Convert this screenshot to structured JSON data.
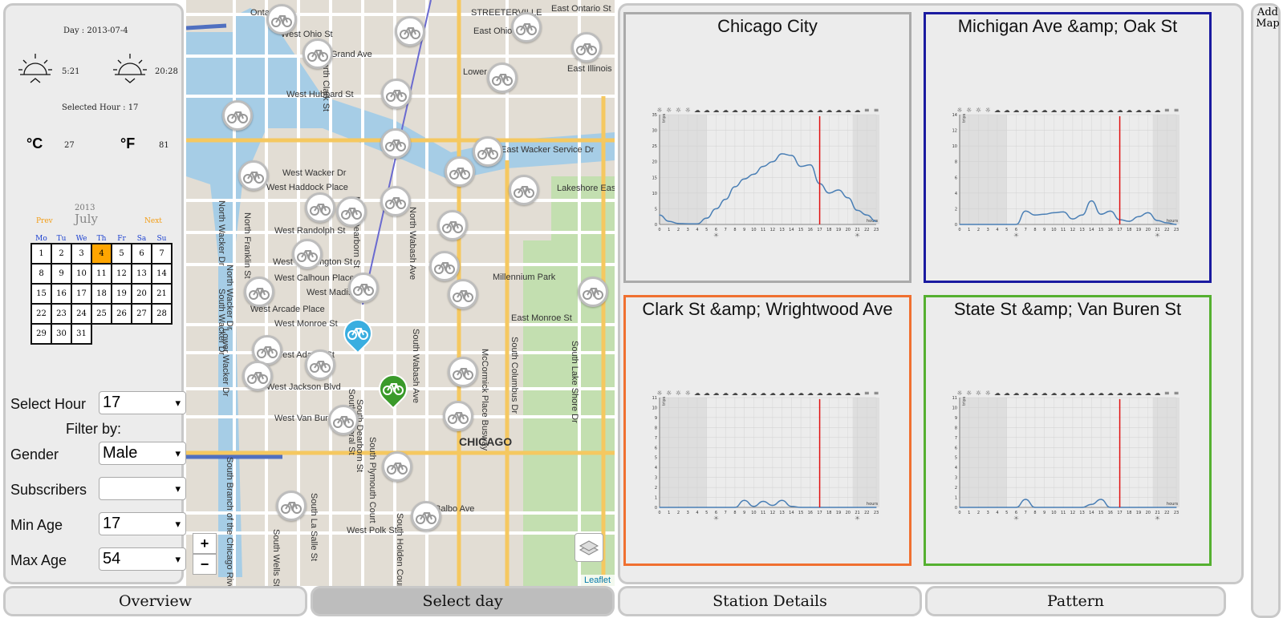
{
  "left": {
    "day_label": "Day : 2013-07-4",
    "sunrise": "5:21",
    "sunset": "20:28",
    "selected_hour_label": "Selected Hour : 17",
    "celsius_symbol": "°C",
    "celsius_value": "27",
    "fahrenheit_symbol": "°F",
    "fahrenheit_value": "81",
    "calendar": {
      "year": "2013",
      "month": "July",
      "prev": "Prev",
      "next": "Next",
      "weekdays": [
        "Mo",
        "Tu",
        "We",
        "Th",
        "Fr",
        "Sa",
        "Su"
      ],
      "weeks": [
        [
          "1",
          "2",
          "3",
          "4",
          "5",
          "6",
          "7"
        ],
        [
          "8",
          "9",
          "10",
          "11",
          "12",
          "13",
          "14"
        ],
        [
          "15",
          "16",
          "17",
          "18",
          "19",
          "20",
          "21"
        ],
        [
          "22",
          "23",
          "24",
          "25",
          "26",
          "27",
          "28"
        ],
        [
          "29",
          "30",
          "31",
          "",
          "",
          "",
          ""
        ]
      ],
      "selected_day": "4"
    },
    "form": {
      "select_hour_label": "Select Hour",
      "select_hour_value": "17",
      "filter_by": "Filter by:",
      "gender_label": "Gender",
      "gender_value": "Male",
      "subscribers_label": "Subscribers",
      "subscribers_value": "",
      "min_age_label": "Min Age",
      "min_age_value": "17",
      "max_age_label": "Max Age",
      "max_age_value": "54"
    }
  },
  "map": {
    "labels": [
      "Ontario St",
      "East Ontario St",
      "STREETERVILLE",
      "West Ohio St",
      "East Ohio",
      "Grand Ave",
      "East Illinois",
      "West Hubbard St",
      "Lower",
      "East Wacker Service Dr",
      "West Wacker Dr",
      "West Haddock Place",
      "Lakeshore East Park",
      "West Randolph St",
      "West Washington St",
      "West Calhoun Place",
      "Millennium Park",
      "West Madison",
      "West Arcade Place",
      "West Monroe St",
      "East Monroe St",
      "West Adams St",
      "West Jackson Blvd",
      "West Van Buren",
      "CHICAGO",
      "Balbo Ave",
      "West Polk St",
      "North Wacker Dr",
      "North Franklin St",
      "North Clark St",
      "North Dearborn St",
      "North Wabash Ave",
      "South Dearborn St",
      "South Federal St",
      "South Wabash Ave",
      "South Plymouth Court",
      "South Columbus Dr",
      "McCormick Place Busway",
      "South Lake Shore Dr",
      "South Branch of the Chicago River",
      "South La Salle St",
      "South Wells St",
      "South Holden Court",
      "North Wacker Dr",
      "Lower Wacker Dr",
      "South Wacker Dr"
    ],
    "zoom_in": "+",
    "zoom_out": "−",
    "attribution": "Leaflet"
  },
  "charts": [
    {
      "title": "Chicago City",
      "border": "#aaaaaa",
      "ymax": 35,
      "yticks": [
        0,
        5,
        10,
        15,
        20,
        25,
        30,
        35
      ],
      "values": [
        3,
        1,
        0.3,
        0.2,
        0.2,
        2,
        5,
        8,
        12,
        14.5,
        16,
        18.5,
        20,
        22.5,
        22,
        18.5,
        19,
        13,
        10,
        11,
        8.5,
        4.5,
        3,
        1
      ],
      "selected_hour": 17
    },
    {
      "title": "Michigan Ave &amp; Oak St",
      "border": "#1a1aa0",
      "ymax": 14,
      "yticks": [
        0,
        2,
        4,
        6,
        8,
        10,
        12,
        14
      ],
      "values": [
        0,
        0,
        0,
        0,
        0,
        0,
        0,
        1.7,
        1.2,
        1.3,
        1.5,
        1.6,
        0.7,
        1.2,
        3,
        1.3,
        1.7,
        0.6,
        0.4,
        1,
        1.5,
        0.5,
        0.2,
        0
      ],
      "selected_hour": 17
    },
    {
      "title": "Clark St &amp; Wrightwood Ave",
      "border": "#f07030",
      "ymax": 11,
      "yticks": [
        0,
        1,
        2,
        3,
        4,
        5,
        6,
        7,
        8,
        9,
        10,
        11
      ],
      "values": [
        0,
        0,
        0,
        0,
        0,
        0,
        0,
        0,
        0,
        0.7,
        0.1,
        0.6,
        0.2,
        0.7,
        0.1,
        0,
        0,
        0,
        0,
        0,
        0,
        0,
        0,
        0
      ],
      "selected_hour": 17
    },
    {
      "title": "State St &amp; Van Buren St",
      "border": "#55b030",
      "ymax": 11,
      "yticks": [
        0,
        1,
        2,
        3,
        4,
        5,
        6,
        7,
        8,
        9,
        10,
        11
      ],
      "values": [
        0,
        0,
        0,
        0,
        0,
        0,
        0,
        0.8,
        0,
        0,
        0,
        0,
        0,
        0,
        0.3,
        0.8,
        0,
        0,
        0,
        0,
        0,
        0,
        0,
        0
      ],
      "selected_hour": 17
    }
  ],
  "chart_axis": {
    "hours": [
      "0",
      "1",
      "2",
      "3",
      "4",
      "5",
      "6",
      "7",
      "8",
      "9",
      "10",
      "11",
      "12",
      "13",
      "14",
      "15",
      "16",
      "17",
      "18",
      "19",
      "20",
      "21",
      "22",
      "23"
    ],
    "x_unit": "hours",
    "y_unit": "trips"
  },
  "add_map": "Add Map",
  "tabs": [
    "Overview",
    "Select day",
    "Station Details",
    "Pattern"
  ],
  "active_tab": 1
}
